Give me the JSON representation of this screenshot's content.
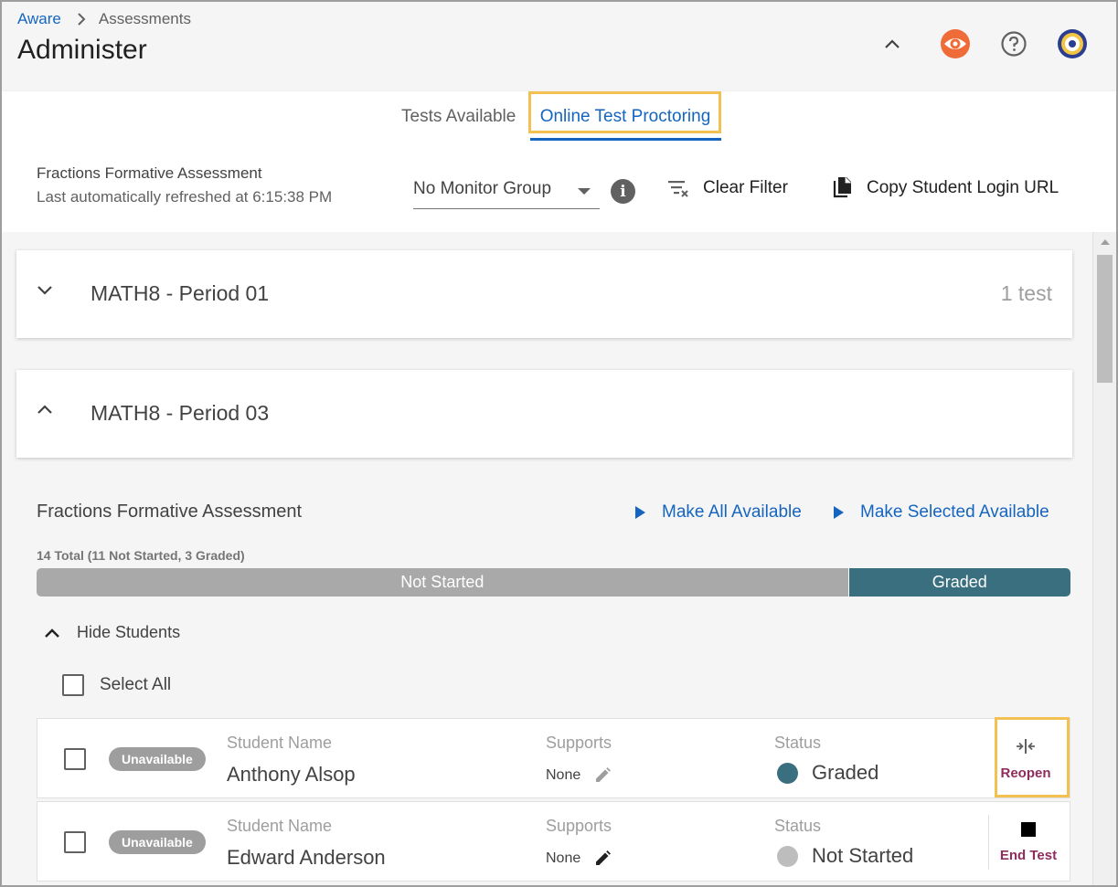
{
  "breadcrumb": {
    "root": "Aware",
    "current": "Assessments"
  },
  "page": {
    "title": "Administer"
  },
  "header_icons": [
    "chevron-up-icon",
    "eye-icon",
    "help-icon",
    "avatar"
  ],
  "tabs": [
    {
      "label": "Tests Available",
      "active": false
    },
    {
      "label": "Online Test Proctoring",
      "active": true
    }
  ],
  "toolbar": {
    "assessment_title": "Fractions Formative Assessment",
    "refresh_text": "Last automatically refreshed at 6:15:38 PM",
    "monitor_group": "No Monitor Group",
    "clear_filter": "Clear Filter",
    "copy_url": "Copy Student Login URL"
  },
  "groups": [
    {
      "title": "MATH8 - Period 01",
      "count": "1 test",
      "expanded": false
    },
    {
      "title": "MATH8 - Period 03",
      "count": "",
      "expanded": true
    }
  ],
  "assessment": {
    "title": "Fractions Formative Assessment",
    "make_all": "Make All Available",
    "make_selected": "Make Selected Available",
    "total_text": "14 Total (11 Not Started, 3 Graded)",
    "progress": [
      {
        "label": "Not Started",
        "count": 11,
        "color": "#a9a9a9"
      },
      {
        "label": "Graded",
        "count": 3,
        "color": "#3a6f7f"
      }
    ],
    "hide_students": "Hide Students",
    "select_all": "Select All"
  },
  "columns": {
    "name": "Student Name",
    "supports": "Supports",
    "status": "Status"
  },
  "students": [
    {
      "availability": "Unavailable",
      "name": "Anthony Alsop",
      "supports": "None",
      "status": "Graded",
      "status_color": "#3a6f7f",
      "action": "Reopen"
    },
    {
      "availability": "Unavailable",
      "name": "Edward Anderson",
      "supports": "None",
      "status": "Not Started",
      "status_color": "#bdbdbd",
      "action": "End Test"
    }
  ],
  "colors": {
    "accent": "#1565c0",
    "highlight": "#f3c052",
    "action": "#8e2d5c",
    "eye_icon": "#ef6c38"
  }
}
